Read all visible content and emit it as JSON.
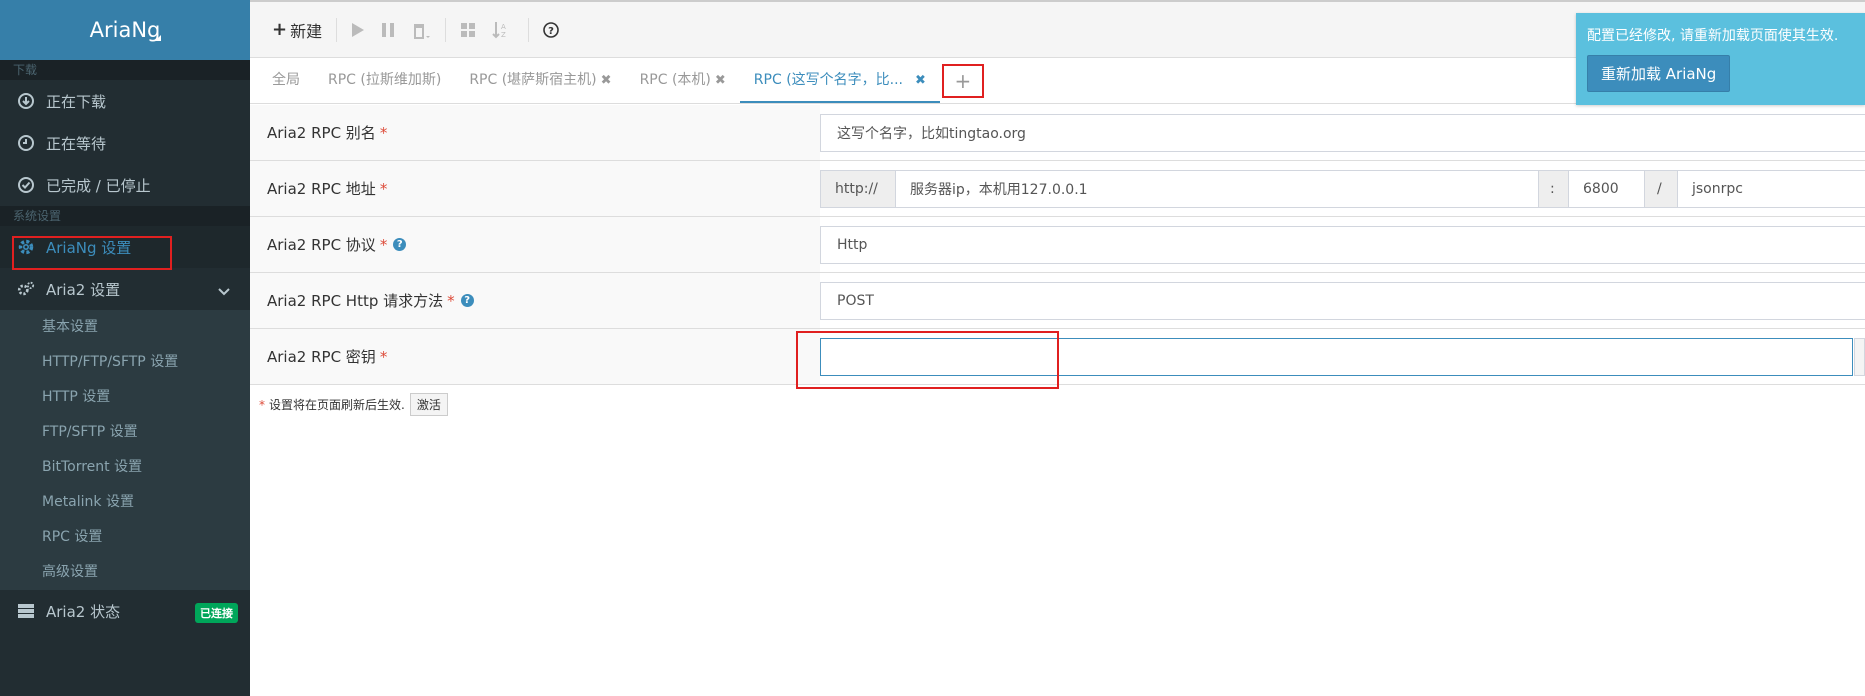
{
  "app": {
    "title": "AriaNg"
  },
  "sidebar": {
    "section_download": "下载",
    "downloading": "正在下载",
    "waiting": "正在等待",
    "stopped": "已完成 / 已停止",
    "section_settings": "系统设置",
    "ariang_settings": "AriaNg 设置",
    "aria2_settings": "Aria2 设置",
    "sub_items": [
      "基本设置",
      "HTTP/FTP/SFTP 设置",
      "HTTP 设置",
      "FTP/SFTP 设置",
      "BitTorrent 设置",
      "Metalink 设置",
      "RPC 设置",
      "高级设置"
    ],
    "aria2_status": "Aria2 状态",
    "status_badge": "已连接"
  },
  "toolbar": {
    "new_label": "新建"
  },
  "tabs": {
    "global": "全局",
    "rpc1": "RPC (拉斯维加斯)",
    "rpc2": "RPC (堪萨斯宿主机)",
    "rpc3": "RPC (本机)",
    "rpc4": "RPC (这写个名字，比...",
    "add": "+"
  },
  "form": {
    "alias_label": "Aria2 RPC 别名",
    "alias_value": "这写个名字，比如tingtao.org",
    "address_label": "Aria2 RPC 地址",
    "address_scheme": "http://",
    "address_host": "服务器ip，本机用127.0.0.1",
    "address_colon": ":",
    "address_port": "6800",
    "address_slash": "/",
    "address_path": "jsonrpc",
    "protocol_label": "Aria2 RPC 协议",
    "protocol_value": "Http",
    "method_label": "Aria2 RPC Http 请求方法",
    "method_value": "POST",
    "secret_label": "Aria2 RPC 密钥",
    "secret_value": "",
    "required_mark": "*"
  },
  "note": {
    "text": "设置将在页面刷新后生效.",
    "button": "激活"
  },
  "toast": {
    "message": "配置已经修改, 请重新加载页面使其生效.",
    "button": "重新加载 AriaNg"
  }
}
